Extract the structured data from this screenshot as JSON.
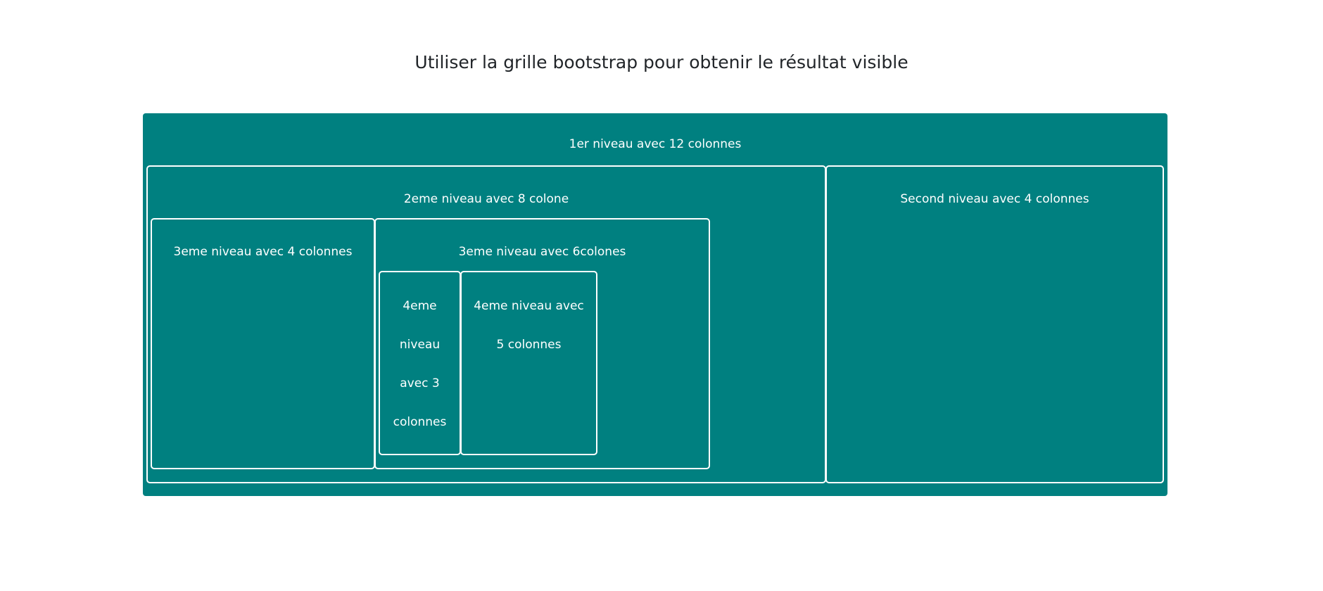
{
  "page": {
    "title": "Utiliser la grille bootstrap pour obtenir le résultat visible"
  },
  "grid": {
    "level1": {
      "label": "1er niveau avec 12 colonnes"
    },
    "level2_left": {
      "label": "2eme niveau avec 8 colone"
    },
    "level2_right": {
      "label": "Second niveau avec 4 colonnes"
    },
    "level3_left": {
      "label": "3eme niveau avec 4 colonnes"
    },
    "level3_right": {
      "label": "3eme niveau avec 6colones"
    },
    "level4_left": {
      "lines": [
        "4eme",
        "niveau",
        "avec 3",
        "colonnes"
      ]
    },
    "level4_right": {
      "lines": [
        "4eme niveau avec",
        "5 colonnes"
      ]
    }
  },
  "colors": {
    "teal": "#008080",
    "border": "#ffffff",
    "title_text": "#212529"
  }
}
